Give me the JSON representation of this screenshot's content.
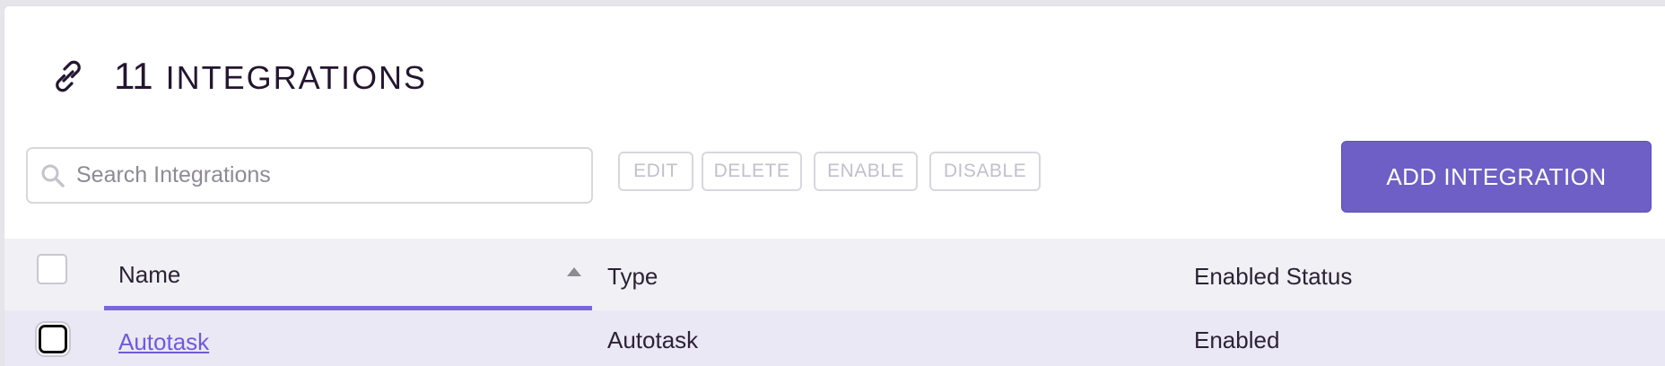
{
  "header": {
    "count": "11",
    "label": "INTEGRATIONS",
    "icon": "link-icon"
  },
  "search": {
    "placeholder": "Search Integrations",
    "value": "",
    "icon": "search-icon"
  },
  "toolbar": {
    "edit_label": "EDIT",
    "delete_label": "DELETE",
    "enable_label": "ENABLE",
    "disable_label": "DISABLE",
    "add_label": "ADD INTEGRATION"
  },
  "table": {
    "columns": [
      "Name",
      "Type",
      "Enabled Status"
    ],
    "sort": {
      "column": "Name",
      "direction": "ascending"
    },
    "rows": [
      {
        "name": "Autotask",
        "type": "Autotask",
        "status": "Enabled"
      }
    ]
  },
  "colors": {
    "accent": "#6e5fc6",
    "sort_underline": "#7a66df",
    "link": "#6f5bd8",
    "row_highlight": "#ebe8f5"
  }
}
